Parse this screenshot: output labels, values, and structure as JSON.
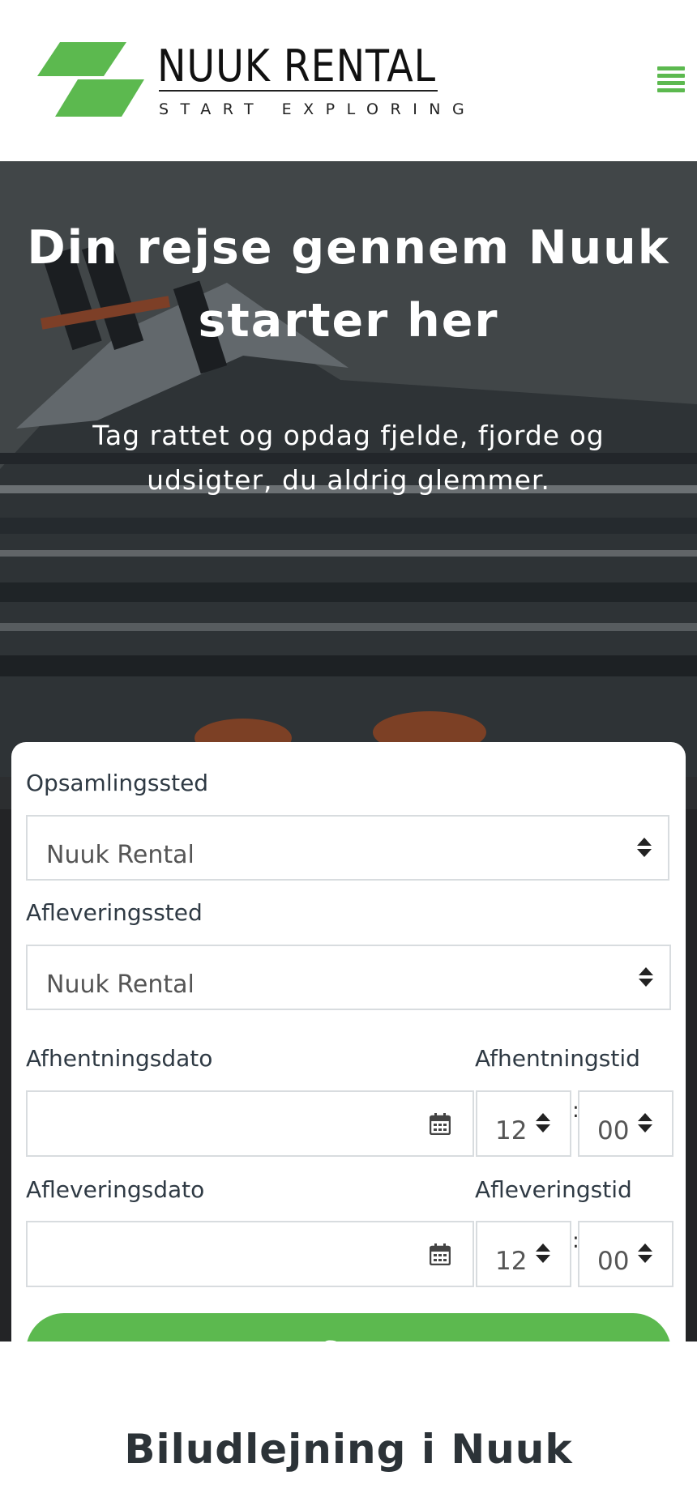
{
  "header": {
    "logo_title": "NUUK RENTAL",
    "logo_tagline": "START EXPLORING",
    "menu_icon": "hamburger-menu-icon"
  },
  "hero": {
    "title": "Din rejse gennem Nuuk starter her",
    "subtitle": "Tag rattet og opdag fjelde, fjorde og udsigter, du aldrig glemmer."
  },
  "booking": {
    "pickup_location_label": "Opsamlingssted",
    "pickup_location_value": "Nuuk Rental",
    "dropoff_location_label": "Afleveringssted",
    "dropoff_location_value": "Nuuk Rental",
    "pickup_date_label": "Afhentningsdato",
    "pickup_date_value": "",
    "pickup_time_label": "Afhentningstid",
    "pickup_hour": "12",
    "pickup_minute": "00",
    "dropoff_date_label": "Afleveringsdato",
    "dropoff_date_value": "",
    "dropoff_time_label": "Afleveringstid",
    "dropoff_hour": "12",
    "dropoff_minute": "00",
    "time_separator": ":",
    "search_label": "Søg"
  },
  "section": {
    "title": "Biludlejning i Nuuk"
  },
  "colors": {
    "brand_green": "#5cb94f",
    "text_dark": "#2c3338",
    "field_border": "#d8dcdf"
  },
  "icons": {
    "select_arrows": "sort-arrows-icon",
    "calendar": "calendar-icon"
  }
}
